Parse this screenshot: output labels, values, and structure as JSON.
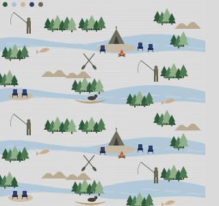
{
  "pattern": {
    "motifs": [
      "fisherman-icon",
      "tent-icon",
      "campfire-icon",
      "chair-icon",
      "canoe-icon",
      "dog-icon",
      "paddles-icon",
      "pine-tree-icon",
      "mountain-icon",
      "leaping-fish-icon",
      "river-icon"
    ],
    "colors": {
      "background": "#d9dad9",
      "water": "#a8c4d6",
      "water_light": "#c7d8e3",
      "pine_dark": "#2f5a3a",
      "pine_mid": "#4d7a52",
      "pine_light": "#8fae8a",
      "sand": "#c9b79a",
      "mountain": "#b9ab92",
      "canoe": "#c4ac86",
      "fisherman": "#6b6a52",
      "tent": "#6e6c5e",
      "chair_blue": "#2f3f6f",
      "fire": "#c8572f",
      "fish": "#c9ad8e",
      "dog": "#4a3f33"
    },
    "selvage": {
      "dot_colors": [
        "#2f5a3a",
        "#a8c4d6",
        "#c9b79a",
        "#2f3f6f",
        "#6b6a52"
      ]
    }
  }
}
